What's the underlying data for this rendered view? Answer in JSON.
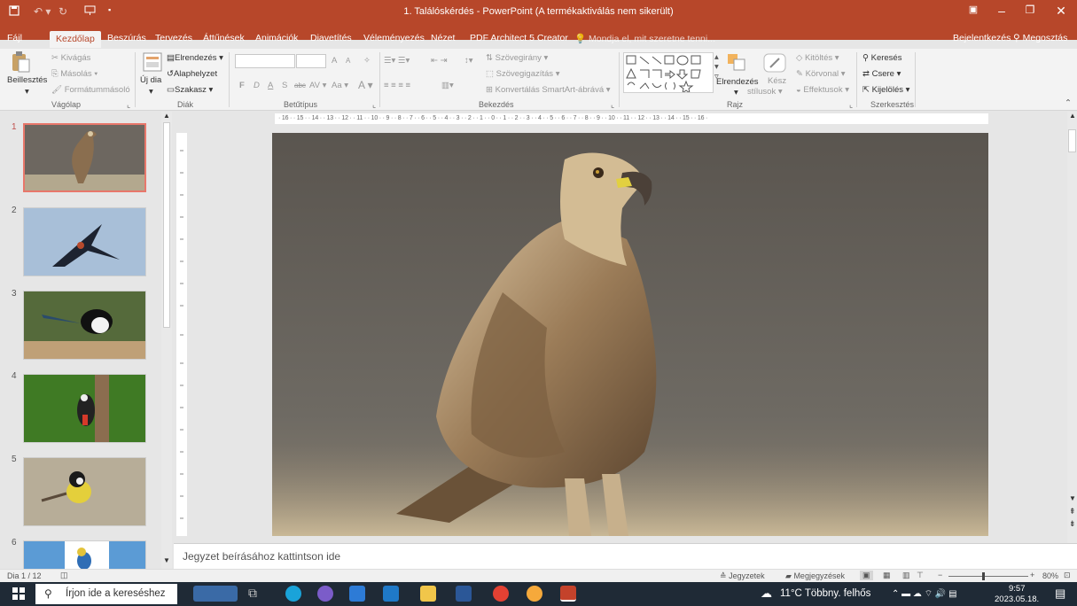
{
  "window": {
    "title": "1. Találóskérdés - PowerPoint (A termékaktiválás nem sikerült)"
  },
  "tabs": [
    "Fájl",
    "Kezdőlap",
    "Beszúrás",
    "Tervezés",
    "Áttűnések",
    "Animációk",
    "Diavetítés",
    "Véleményezés",
    "Nézet",
    "PDF Architect 5 Creator"
  ],
  "tell_me": "Mondja el, mit szeretne tenni...",
  "account": {
    "signin": "Bejelentkezés",
    "share": "Megosztás"
  },
  "ribbon": {
    "clipboard": {
      "paste": "Beillesztés",
      "cut": "Kivágás",
      "copy": "Másolás",
      "format_painter": "Formátummásoló",
      "label": "Vágólap"
    },
    "slides": {
      "new_slide": "Új dia",
      "layout": "Elrendezés",
      "reset": "Alaphelyzet",
      "section": "Szakasz",
      "label": "Diák"
    },
    "font": {
      "bold": "F",
      "italic": "D",
      "underline": "A",
      "shadow": "S",
      "strike": "abc",
      "spacing": "AV",
      "case": "Aa",
      "color": "A",
      "grow": "A",
      "shrink": "A",
      "label": "Betűtípus"
    },
    "paragraph": {
      "text_direction": "Szövegirány",
      "align_text": "Szövegigazítás",
      "smartart": "Konvertálás SmartArt-ábrává",
      "label": "Bekezdés"
    },
    "drawing": {
      "arrange": "Elrendezés",
      "quick_styles_1": "Kész",
      "quick_styles_2": "stílusok",
      "fill": "Kitöltés",
      "outline": "Körvonal",
      "effects": "Effektusok",
      "label": "Rajz"
    },
    "editing": {
      "find": "Keresés",
      "replace": "Csere",
      "select": "Kijelölés",
      "label": "Szerkesztés"
    }
  },
  "ruler": {
    "horizontal": "· 16 · · 15 · · 14 · · 13 · · 12 · · 11 · · 10 · · 9 · · 8 · · 7 · · 6 · · 5 · · 4 · · 3 · · 2 · · 1 · · 0 · · 1 · · 2 · · 3 · · 4 · · 5 · · 6 · · 7 · · 8 · · 9 · · 10 · · 11 · · 12 · · 13 · · 14 · · 15 · · 16 ·"
  },
  "slides": [
    {
      "num": "1"
    },
    {
      "num": "2"
    },
    {
      "num": "3"
    },
    {
      "num": "4"
    },
    {
      "num": "5"
    },
    {
      "num": "6"
    }
  ],
  "notes_placeholder": "Jegyzet beírásához kattintson ide",
  "status": {
    "slide": "Dia 1 / 12",
    "notes": "Jegyzetek",
    "comments": "Megjegyzések",
    "zoom": "80%"
  },
  "taskbar": {
    "search": "Írjon ide a kereséshez",
    "weather": "11°C  Többny. felhős",
    "time": "9:57",
    "date": "2023.05.18."
  }
}
